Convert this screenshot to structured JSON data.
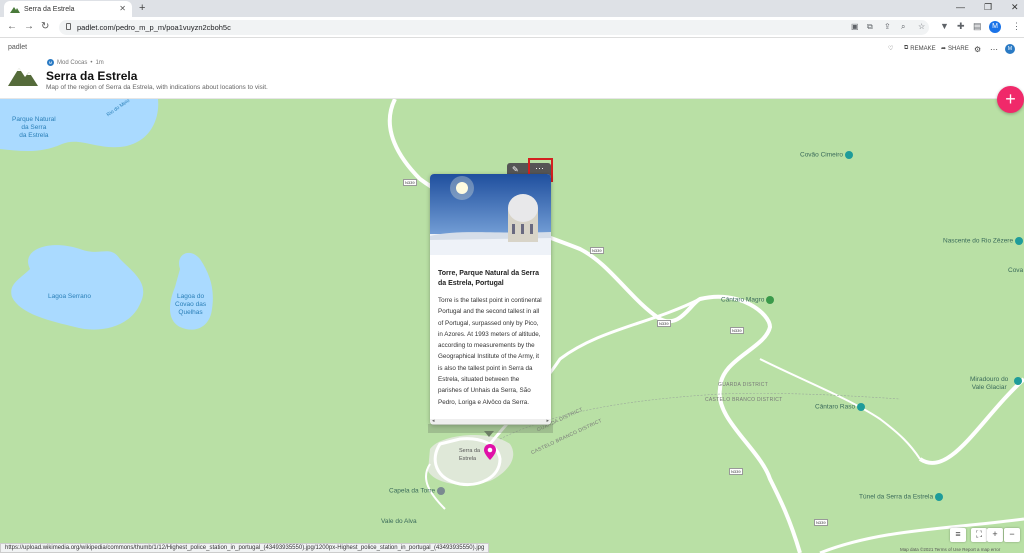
{
  "browser": {
    "tab_title": "Serra da Estrela",
    "new_tab": "+",
    "url": "padlet.com/pedro_m_p_m/poa1vuyzn2cboh5c",
    "profile_initial": "M"
  },
  "header": {
    "brand": "padlet",
    "author_initial": "M",
    "author": "Mod Cocas",
    "time": "1m",
    "title": "Serra da Estrela",
    "description": "Map of the region of Serra da Estrela, with indications about locations to visit.",
    "actions": {
      "remake": "REMAKE",
      "share": "SHARE"
    },
    "avatar_initial": "M"
  },
  "map": {
    "lakes": [
      {
        "name": "Parque Natural\nda Serra\nda Estrela"
      },
      {
        "name": "Lagoa Serrano"
      },
      {
        "name": "Lagoa do\nCovao das\nQuelhas"
      }
    ],
    "places": {
      "covao_cimeiro": "Covão Cimeiro",
      "nascente": "Nascente do Rio Zêzere",
      "cantaro_magro": "Cântaro Magro",
      "cantaro_raso": "Cântaro Raso",
      "miradouro": "Miradouro do\nVale Glaciar",
      "tunel": "Túnel da Serra da Estrela",
      "capela": "Capela da Torre",
      "vale_alva": "Vale do Alva",
      "serra_estrela_pin": "Serra da\nEstrela",
      "cova": "Cova",
      "rio_meio": "Rio do Meio"
    },
    "districts": {
      "guarda": "GUARDA DISTRICT",
      "castelo_branco": "CASTELO BRANCO DISTRICT",
      "castelo_branco_2": "CASTELO BRANCO DISTRICT",
      "guarda_2": "GUARDA DISTRICT"
    },
    "road_shields": [
      "N339",
      "N339",
      "N339",
      "N339",
      "N339",
      "N339"
    ],
    "attribution": "Map data ©2021   Terms of Use   Report a map error"
  },
  "post": {
    "title": "Torre, Parque Natural da Serra da Estrela, Portugal",
    "body": "Torre is the tallest point in continental Portugal and the second tallest in all of Portugal, surpassed only by Pico, in Azores. At 1993 meters of altitude, according to measurements by the Geographical Institute of the Army, it is also the tallest point in Serra da Estrela, situated between the parishes of Unhais da Serra, São Pedro, Loriga e Alvôco da Serra."
  },
  "status_url": "https://upload.wikimedia.org/wikipedia/commons/thumb/1/12/Highest_police_station_in_portugal_(43493935550).jpg/1200px-Highest_police_station_in_portugal_(43493935550).jpg",
  "colors": {
    "map_land": "#b9e0a5",
    "water": "#aadaff",
    "road": "#ffffff",
    "fab": "#f0296a",
    "pin": "#e011a8",
    "highlight": "#d32020"
  }
}
